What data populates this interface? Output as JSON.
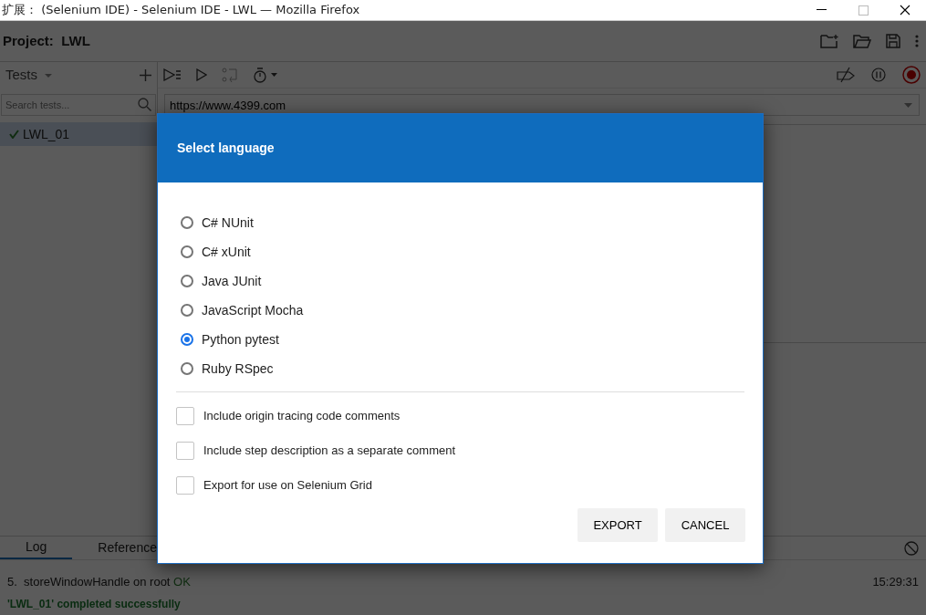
{
  "window": {
    "title": "扩展： (Selenium IDE) - Selenium IDE - LWL — Mozilla Firefox"
  },
  "project": {
    "label": "Project:",
    "name": "LWL"
  },
  "tests_panel": {
    "title": "Tests",
    "search": {
      "placeholder": "Search tests..."
    },
    "tests": [
      {
        "name": "LWL_01",
        "passed": true,
        "selected": true
      }
    ]
  },
  "url": {
    "value": "https://www.4399.com"
  },
  "log_panel": {
    "tabs": [
      {
        "label": "Log",
        "selected": true
      },
      {
        "label": "Reference",
        "selected": false
      }
    ],
    "entries": [
      {
        "index": "5.",
        "text": "storeWindowHandle on root",
        "result": "OK",
        "time": "15:29:31"
      }
    ],
    "summary": "'LWL_01' completed successfully"
  },
  "dialog": {
    "title": "Select language",
    "languages": [
      {
        "label": "C# NUnit",
        "selected": false
      },
      {
        "label": "C# xUnit",
        "selected": false
      },
      {
        "label": "Java JUnit",
        "selected": false
      },
      {
        "label": "JavaScript Mocha",
        "selected": false
      },
      {
        "label": "Python pytest",
        "selected": true
      },
      {
        "label": "Ruby RSpec",
        "selected": false
      }
    ],
    "options": [
      {
        "label": "Include origin tracing code comments",
        "checked": false
      },
      {
        "label": "Include step description as a separate comment",
        "checked": false
      },
      {
        "label": "Export for use on Selenium Grid",
        "checked": false
      }
    ],
    "buttons": [
      "EXPORT",
      "CANCEL"
    ]
  }
}
